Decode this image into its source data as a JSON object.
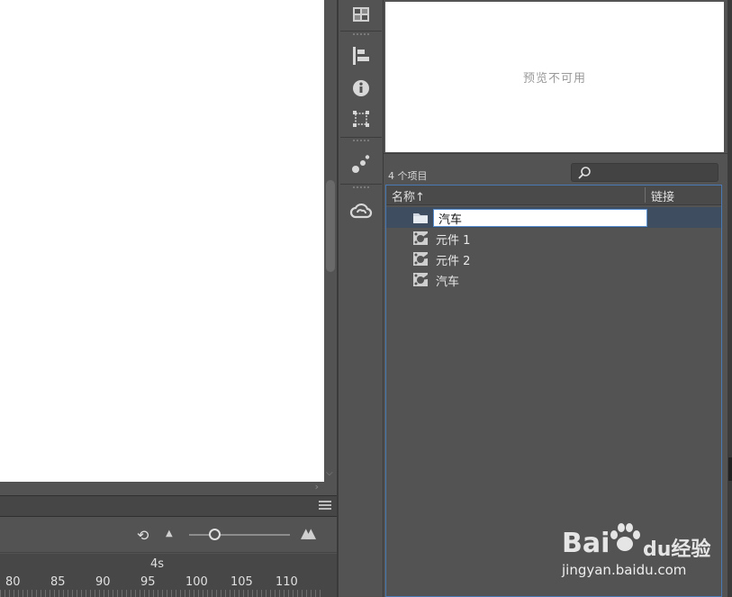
{
  "preview": {
    "text": "预览不可用"
  },
  "library": {
    "item_count": "4 个项目",
    "search_placeholder": "",
    "columns": {
      "name": "名称",
      "sort_arrow": "↑",
      "linkage": "链接"
    },
    "rename_value": "汽车",
    "items": [
      {
        "label": "元件 1",
        "type": "movieclip"
      },
      {
        "label": "元件 2",
        "type": "movieclip"
      },
      {
        "label": "汽车",
        "type": "movieclip"
      }
    ]
  },
  "timeline": {
    "time_label": "4s",
    "frame_numbers": [
      "80",
      "85",
      "90",
      "95",
      "100",
      "105",
      "110"
    ],
    "zoom_level": 0.25
  },
  "watermark": {
    "brand": "Bai",
    "brand_suffix": "du",
    "product": "经验",
    "url": "jingyan.baidu.com"
  },
  "colors": {
    "accent": "#4a7ab5",
    "selected_row": "#3f4d60",
    "panel": "#535353"
  }
}
